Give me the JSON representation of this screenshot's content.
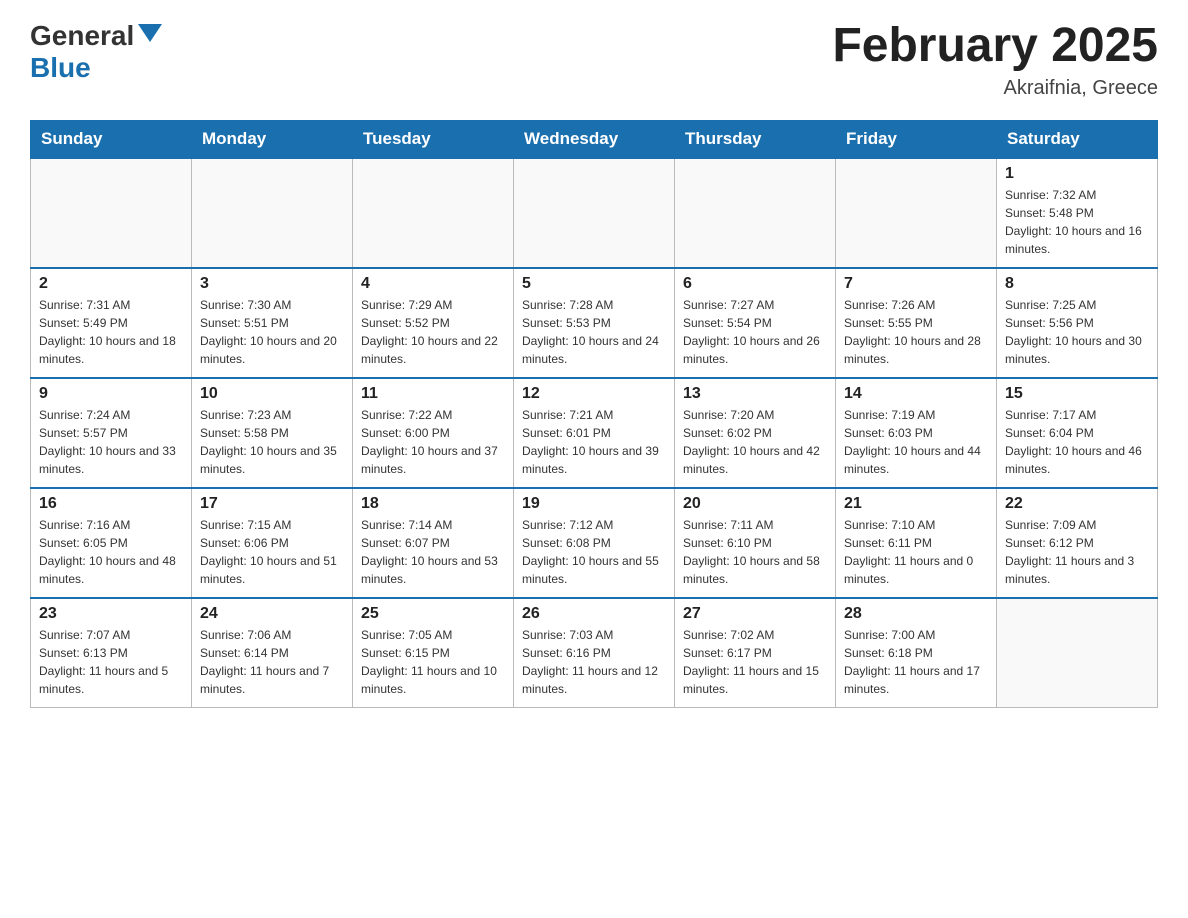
{
  "header": {
    "logo_general": "General",
    "logo_blue": "Blue",
    "month_title": "February 2025",
    "location": "Akraifnia, Greece"
  },
  "days_of_week": [
    "Sunday",
    "Monday",
    "Tuesday",
    "Wednesday",
    "Thursday",
    "Friday",
    "Saturday"
  ],
  "weeks": [
    [
      {
        "day": "",
        "sunrise": "",
        "sunset": "",
        "daylight": ""
      },
      {
        "day": "",
        "sunrise": "",
        "sunset": "",
        "daylight": ""
      },
      {
        "day": "",
        "sunrise": "",
        "sunset": "",
        "daylight": ""
      },
      {
        "day": "",
        "sunrise": "",
        "sunset": "",
        "daylight": ""
      },
      {
        "day": "",
        "sunrise": "",
        "sunset": "",
        "daylight": ""
      },
      {
        "day": "",
        "sunrise": "",
        "sunset": "",
        "daylight": ""
      },
      {
        "day": "1",
        "sunrise": "Sunrise: 7:32 AM",
        "sunset": "Sunset: 5:48 PM",
        "daylight": "Daylight: 10 hours and 16 minutes."
      }
    ],
    [
      {
        "day": "2",
        "sunrise": "Sunrise: 7:31 AM",
        "sunset": "Sunset: 5:49 PM",
        "daylight": "Daylight: 10 hours and 18 minutes."
      },
      {
        "day": "3",
        "sunrise": "Sunrise: 7:30 AM",
        "sunset": "Sunset: 5:51 PM",
        "daylight": "Daylight: 10 hours and 20 minutes."
      },
      {
        "day": "4",
        "sunrise": "Sunrise: 7:29 AM",
        "sunset": "Sunset: 5:52 PM",
        "daylight": "Daylight: 10 hours and 22 minutes."
      },
      {
        "day": "5",
        "sunrise": "Sunrise: 7:28 AM",
        "sunset": "Sunset: 5:53 PM",
        "daylight": "Daylight: 10 hours and 24 minutes."
      },
      {
        "day": "6",
        "sunrise": "Sunrise: 7:27 AM",
        "sunset": "Sunset: 5:54 PM",
        "daylight": "Daylight: 10 hours and 26 minutes."
      },
      {
        "day": "7",
        "sunrise": "Sunrise: 7:26 AM",
        "sunset": "Sunset: 5:55 PM",
        "daylight": "Daylight: 10 hours and 28 minutes."
      },
      {
        "day": "8",
        "sunrise": "Sunrise: 7:25 AM",
        "sunset": "Sunset: 5:56 PM",
        "daylight": "Daylight: 10 hours and 30 minutes."
      }
    ],
    [
      {
        "day": "9",
        "sunrise": "Sunrise: 7:24 AM",
        "sunset": "Sunset: 5:57 PM",
        "daylight": "Daylight: 10 hours and 33 minutes."
      },
      {
        "day": "10",
        "sunrise": "Sunrise: 7:23 AM",
        "sunset": "Sunset: 5:58 PM",
        "daylight": "Daylight: 10 hours and 35 minutes."
      },
      {
        "day": "11",
        "sunrise": "Sunrise: 7:22 AM",
        "sunset": "Sunset: 6:00 PM",
        "daylight": "Daylight: 10 hours and 37 minutes."
      },
      {
        "day": "12",
        "sunrise": "Sunrise: 7:21 AM",
        "sunset": "Sunset: 6:01 PM",
        "daylight": "Daylight: 10 hours and 39 minutes."
      },
      {
        "day": "13",
        "sunrise": "Sunrise: 7:20 AM",
        "sunset": "Sunset: 6:02 PM",
        "daylight": "Daylight: 10 hours and 42 minutes."
      },
      {
        "day": "14",
        "sunrise": "Sunrise: 7:19 AM",
        "sunset": "Sunset: 6:03 PM",
        "daylight": "Daylight: 10 hours and 44 minutes."
      },
      {
        "day": "15",
        "sunrise": "Sunrise: 7:17 AM",
        "sunset": "Sunset: 6:04 PM",
        "daylight": "Daylight: 10 hours and 46 minutes."
      }
    ],
    [
      {
        "day": "16",
        "sunrise": "Sunrise: 7:16 AM",
        "sunset": "Sunset: 6:05 PM",
        "daylight": "Daylight: 10 hours and 48 minutes."
      },
      {
        "day": "17",
        "sunrise": "Sunrise: 7:15 AM",
        "sunset": "Sunset: 6:06 PM",
        "daylight": "Daylight: 10 hours and 51 minutes."
      },
      {
        "day": "18",
        "sunrise": "Sunrise: 7:14 AM",
        "sunset": "Sunset: 6:07 PM",
        "daylight": "Daylight: 10 hours and 53 minutes."
      },
      {
        "day": "19",
        "sunrise": "Sunrise: 7:12 AM",
        "sunset": "Sunset: 6:08 PM",
        "daylight": "Daylight: 10 hours and 55 minutes."
      },
      {
        "day": "20",
        "sunrise": "Sunrise: 7:11 AM",
        "sunset": "Sunset: 6:10 PM",
        "daylight": "Daylight: 10 hours and 58 minutes."
      },
      {
        "day": "21",
        "sunrise": "Sunrise: 7:10 AM",
        "sunset": "Sunset: 6:11 PM",
        "daylight": "Daylight: 11 hours and 0 minutes."
      },
      {
        "day": "22",
        "sunrise": "Sunrise: 7:09 AM",
        "sunset": "Sunset: 6:12 PM",
        "daylight": "Daylight: 11 hours and 3 minutes."
      }
    ],
    [
      {
        "day": "23",
        "sunrise": "Sunrise: 7:07 AM",
        "sunset": "Sunset: 6:13 PM",
        "daylight": "Daylight: 11 hours and 5 minutes."
      },
      {
        "day": "24",
        "sunrise": "Sunrise: 7:06 AM",
        "sunset": "Sunset: 6:14 PM",
        "daylight": "Daylight: 11 hours and 7 minutes."
      },
      {
        "day": "25",
        "sunrise": "Sunrise: 7:05 AM",
        "sunset": "Sunset: 6:15 PM",
        "daylight": "Daylight: 11 hours and 10 minutes."
      },
      {
        "day": "26",
        "sunrise": "Sunrise: 7:03 AM",
        "sunset": "Sunset: 6:16 PM",
        "daylight": "Daylight: 11 hours and 12 minutes."
      },
      {
        "day": "27",
        "sunrise": "Sunrise: 7:02 AM",
        "sunset": "Sunset: 6:17 PM",
        "daylight": "Daylight: 11 hours and 15 minutes."
      },
      {
        "day": "28",
        "sunrise": "Sunrise: 7:00 AM",
        "sunset": "Sunset: 6:18 PM",
        "daylight": "Daylight: 11 hours and 17 minutes."
      },
      {
        "day": "",
        "sunrise": "",
        "sunset": "",
        "daylight": ""
      }
    ]
  ]
}
